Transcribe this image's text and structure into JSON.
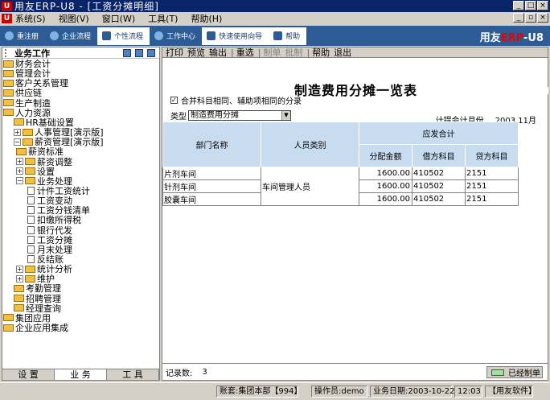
{
  "window": {
    "title": "用友ERP-U8 - [工资分摊明细]",
    "brand_prefix": "用友",
    "brand_erp": "ERP",
    "brand_suffix": "-U8"
  },
  "menu": [
    "系统(S)",
    "视图(V)",
    "窗口(W)",
    "工具(T)",
    "帮助(H)"
  ],
  "toolbar": [
    "重注册",
    "企业流程",
    "个性流程",
    "工作中心",
    "快速使用向导",
    "帮助"
  ],
  "left_pane": {
    "title": "业务工作",
    "tabs": [
      "设 置",
      "业 务",
      "工 具"
    ],
    "tree": [
      {
        "label": "财务会计",
        "level": 0,
        "kind": "folder"
      },
      {
        "label": "管理会计",
        "level": 0,
        "kind": "folder"
      },
      {
        "label": "客户关系管理",
        "level": 0,
        "kind": "folder"
      },
      {
        "label": "供应链",
        "level": 0,
        "kind": "folder"
      },
      {
        "label": "生产制造",
        "level": 0,
        "kind": "folder"
      },
      {
        "label": "人力资源",
        "level": 0,
        "kind": "folder-open"
      },
      {
        "label": "HR基础设置",
        "level": 1,
        "kind": "folder"
      },
      {
        "label": "人事管理[演示版]",
        "level": 1,
        "kind": "folder-plus"
      },
      {
        "label": "薪资管理[演示版]",
        "level": 1,
        "kind": "folder-minus"
      },
      {
        "label": "薪资标准",
        "level": 2,
        "kind": "folder"
      },
      {
        "label": "薪资调整",
        "level": 2,
        "kind": "folder-plus"
      },
      {
        "label": "设置",
        "level": 2,
        "kind": "folder-plus"
      },
      {
        "label": "业务处理",
        "level": 2,
        "kind": "folder-minus"
      },
      {
        "label": "计件工资统计",
        "level": 3,
        "kind": "doc"
      },
      {
        "label": "工资变动",
        "level": 3,
        "kind": "doc"
      },
      {
        "label": "工资分钱清单",
        "level": 3,
        "kind": "doc"
      },
      {
        "label": "扣缴所得税",
        "level": 3,
        "kind": "doc"
      },
      {
        "label": "银行代发",
        "level": 3,
        "kind": "doc"
      },
      {
        "label": "工资分摊",
        "level": 3,
        "kind": "doc"
      },
      {
        "label": "月末处理",
        "level": 3,
        "kind": "doc"
      },
      {
        "label": "反结账",
        "level": 3,
        "kind": "doc"
      },
      {
        "label": "统计分析",
        "level": 2,
        "kind": "folder-plus"
      },
      {
        "label": "维护",
        "level": 2,
        "kind": "folder-plus"
      },
      {
        "label": "考勤管理",
        "level": 1,
        "kind": "folder"
      },
      {
        "label": "招聘管理",
        "level": 1,
        "kind": "folder"
      },
      {
        "label": "经理查询",
        "level": 1,
        "kind": "folder"
      },
      {
        "label": "集团应用",
        "level": 0,
        "kind": "folder"
      },
      {
        "label": "企业应用集成",
        "level": 0,
        "kind": "folder"
      }
    ]
  },
  "report_toolbar": {
    "items": [
      "打印",
      "预览",
      "输出",
      "重选",
      "制单",
      "批制",
      "帮助",
      "退出"
    ],
    "disabled": [
      "制单",
      "批制"
    ]
  },
  "report": {
    "title": "制造费用分摊一览表",
    "merge_checkbox": "合并科目相同、辅助项相同的分录",
    "merge_checked": true,
    "type_label": "类型",
    "type_value": "制造费用分摊",
    "period_label": "计提会计月份",
    "period_value": "2003.11月",
    "headers": {
      "dept": "部门名称",
      "person_type": "人员类别",
      "group": "应发合计",
      "amount": "分配金额",
      "debit": "借方科目",
      "credit": "贷方科目"
    },
    "rows": [
      {
        "dept": "片剂车间",
        "amount": "1600.00",
        "debit": "410502",
        "credit": "2151"
      },
      {
        "dept": "针剂车间",
        "amount": "1600.00",
        "debit": "410502",
        "credit": "2151"
      },
      {
        "dept": "胶囊车间",
        "amount": "1600.00",
        "debit": "410502",
        "credit": "2151"
      }
    ],
    "person_type_value": "车间管理人员",
    "record_label": "记录数:",
    "record_count": "3",
    "made_label": "已经制单"
  },
  "status_bar": {
    "account": "账套:集团本部【994】",
    "operator": "操作员:demo",
    "biz_date": "业务日期:2003-10-22",
    "time": "12:03",
    "company": "【用友软件】"
  }
}
